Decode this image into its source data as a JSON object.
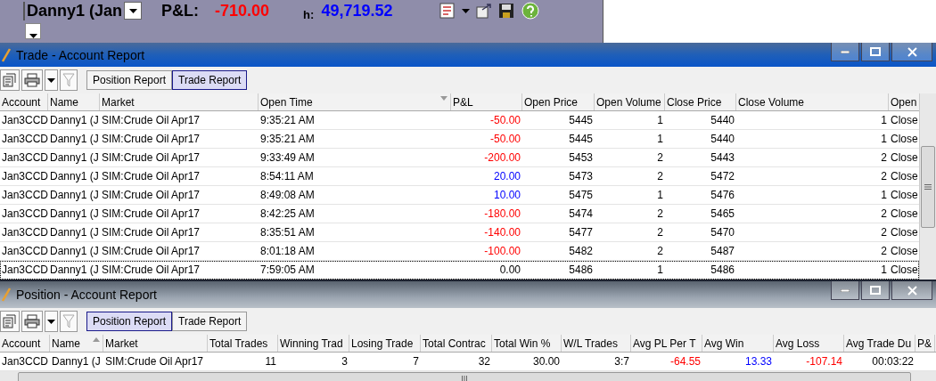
{
  "top_bar": {
    "account_selector": {
      "value": "Danny1 (Jan"
    },
    "pnl_label": "P&L:",
    "pnl_value": "-710.00",
    "cash_label": "h:",
    "cash_value": "49,719.52"
  },
  "windows": [
    {
      "title": "Trade - Account Report",
      "active": true,
      "tabs": [
        {
          "label": "Position Report",
          "selected": false
        },
        {
          "label": "Trade Report",
          "selected": true
        }
      ],
      "table": {
        "columns": [
          {
            "label": "Account"
          },
          {
            "label": "Name"
          },
          {
            "label": "Market"
          },
          {
            "label": "Open Time",
            "sorted_descending": true
          },
          {
            "label": "P&L"
          },
          {
            "label": "Open Price"
          },
          {
            "label": "Open Volume"
          },
          {
            "label": "Close Price"
          },
          {
            "label": "Close Volume"
          },
          {
            "label": "Open"
          }
        ],
        "rows": [
          {
            "selected": false,
            "cells": [
              "Jan3CCD",
              "Danny1 (J",
              "SIM:Crude Oil Apr17",
              "9:35:21 AM",
              {
                "text": "-50.00",
                "color": "#ff0000"
              },
              "5445",
              "1",
              "5440",
              "1",
              "Close"
            ]
          },
          {
            "selected": false,
            "cells": [
              "Jan3CCD",
              "Danny1 (J",
              "SIM:Crude Oil Apr17",
              "9:35:21 AM",
              {
                "text": "-50.00",
                "color": "#ff0000"
              },
              "5445",
              "1",
              "5440",
              "1",
              "Close"
            ]
          },
          {
            "selected": false,
            "cells": [
              "Jan3CCD",
              "Danny1 (J",
              "SIM:Crude Oil Apr17",
              "9:33:49 AM",
              {
                "text": "-200.00",
                "color": "#ff0000"
              },
              "5453",
              "2",
              "5443",
              "2",
              "Close"
            ]
          },
          {
            "selected": false,
            "cells": [
              "Jan3CCD",
              "Danny1 (J",
              "SIM:Crude Oil Apr17",
              "8:54:11 AM",
              {
                "text": "20.00",
                "color": "#0000ff"
              },
              "5473",
              "2",
              "5472",
              "2",
              "Close"
            ]
          },
          {
            "selected": false,
            "cells": [
              "Jan3CCD",
              "Danny1 (J",
              "SIM:Crude Oil Apr17",
              "8:49:08 AM",
              {
                "text": "10.00",
                "color": "#0000ff"
              },
              "5475",
              "1",
              "5476",
              "1",
              "Close"
            ]
          },
          {
            "selected": false,
            "cells": [
              "Jan3CCD",
              "Danny1 (J",
              "SIM:Crude Oil Apr17",
              "8:42:25 AM",
              {
                "text": "-180.00",
                "color": "#ff0000"
              },
              "5474",
              "2",
              "5465",
              "2",
              "Close"
            ]
          },
          {
            "selected": false,
            "cells": [
              "Jan3CCD",
              "Danny1 (J",
              "SIM:Crude Oil Apr17",
              "8:35:51 AM",
              {
                "text": "-140.00",
                "color": "#ff0000"
              },
              "5477",
              "2",
              "5470",
              "2",
              "Close"
            ]
          },
          {
            "selected": false,
            "cells": [
              "Jan3CCD",
              "Danny1 (J",
              "SIM:Crude Oil Apr17",
              "8:01:18 AM",
              {
                "text": "-100.00",
                "color": "#ff0000"
              },
              "5482",
              "2",
              "5487",
              "2",
              "Close"
            ]
          },
          {
            "selected": true,
            "cells": [
              "Jan3CCD",
              "Danny1 (J",
              "SIM:Crude Oil Apr17",
              "7:59:05 AM",
              "0.00",
              "5486",
              "1",
              "5486",
              "1",
              "Close"
            ]
          }
        ]
      }
    },
    {
      "title": "Position - Account Report",
      "active": false,
      "tabs": [
        {
          "label": "Position Report",
          "selected": true
        },
        {
          "label": "Trade Report",
          "selected": false
        }
      ],
      "table": {
        "columns": [
          {
            "label": "Account"
          },
          {
            "label": "Name",
            "sorted_ascending": true
          },
          {
            "label": "Market"
          },
          {
            "label": "Total Trades"
          },
          {
            "label": "Winning Trad"
          },
          {
            "label": "Losing Trade"
          },
          {
            "label": "Total Contrac"
          },
          {
            "label": "Total Win %"
          },
          {
            "label": "W/L Trades"
          },
          {
            "label": "Avg PL Per T"
          },
          {
            "label": "Avg Win"
          },
          {
            "label": "Avg Loss"
          },
          {
            "label": "Avg Trade Du"
          },
          {
            "label": "P&"
          }
        ],
        "rows": [
          {
            "selected": false,
            "cells": [
              "Jan3CCD",
              "Danny1 (J",
              "SIM:Crude Oil Apr17",
              "11",
              "3",
              "7",
              "32",
              "30.00",
              "3:7",
              {
                "text": "-64.55",
                "color": "#ff0000"
              },
              {
                "text": "13.33",
                "color": "#0000ff"
              },
              {
                "text": "-107.14",
                "color": "#ff0000"
              },
              "00:03:22"
            ]
          }
        ]
      }
    }
  ]
}
